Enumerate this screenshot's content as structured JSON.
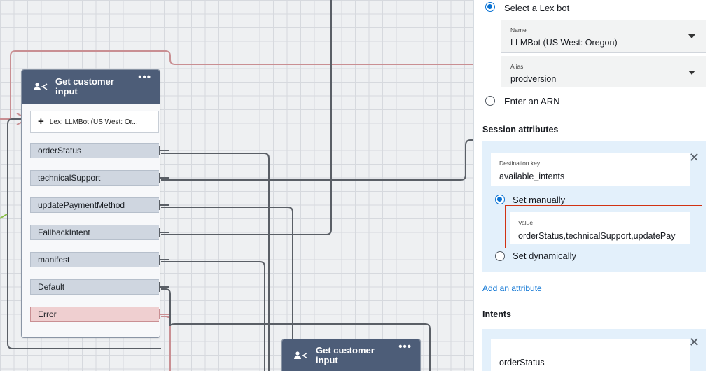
{
  "canvas": {
    "block1": {
      "title": "Get customer input",
      "menu": "•••",
      "lex_row": "Lex: LLMBot (US West: Or...",
      "branches": [
        {
          "label": "orderStatus",
          "type": "normal"
        },
        {
          "label": "technicalSupport",
          "type": "normal"
        },
        {
          "label": "updatePaymentMethod",
          "type": "normal"
        },
        {
          "label": "FallbackIntent",
          "type": "normal"
        },
        {
          "label": " manifest",
          "type": "normal"
        },
        {
          "label": "Default",
          "type": "normal"
        },
        {
          "label": "Error",
          "type": "error"
        }
      ]
    },
    "block2": {
      "title": "Get customer input",
      "menu": "•••"
    },
    "colors": {
      "wire": "#5a5f66",
      "error_wire": "#c98f93",
      "header": "#4d5d78"
    }
  },
  "panel": {
    "bot_option": "Select a Lex bot",
    "name_select": {
      "label": "Name",
      "value": "LLMBot (US West: Oregon)"
    },
    "alias_select": {
      "label": "Alias",
      "value": "prodversion"
    },
    "arn_option": "Enter an ARN",
    "session_heading": "Session attributes",
    "destination_key": {
      "label": "Destination key",
      "value": "available_intents"
    },
    "set_manually": "Set manually",
    "value_field": {
      "label": "Value",
      "value": "orderStatus,technicalSupport,updatePay"
    },
    "set_dynamically": "Set dynamically",
    "add_attribute": "Add an attribute",
    "intents_heading": "Intents",
    "intent_value": "orderStatus",
    "close_symbol": "✕",
    "accent_color": "#0972d3"
  }
}
